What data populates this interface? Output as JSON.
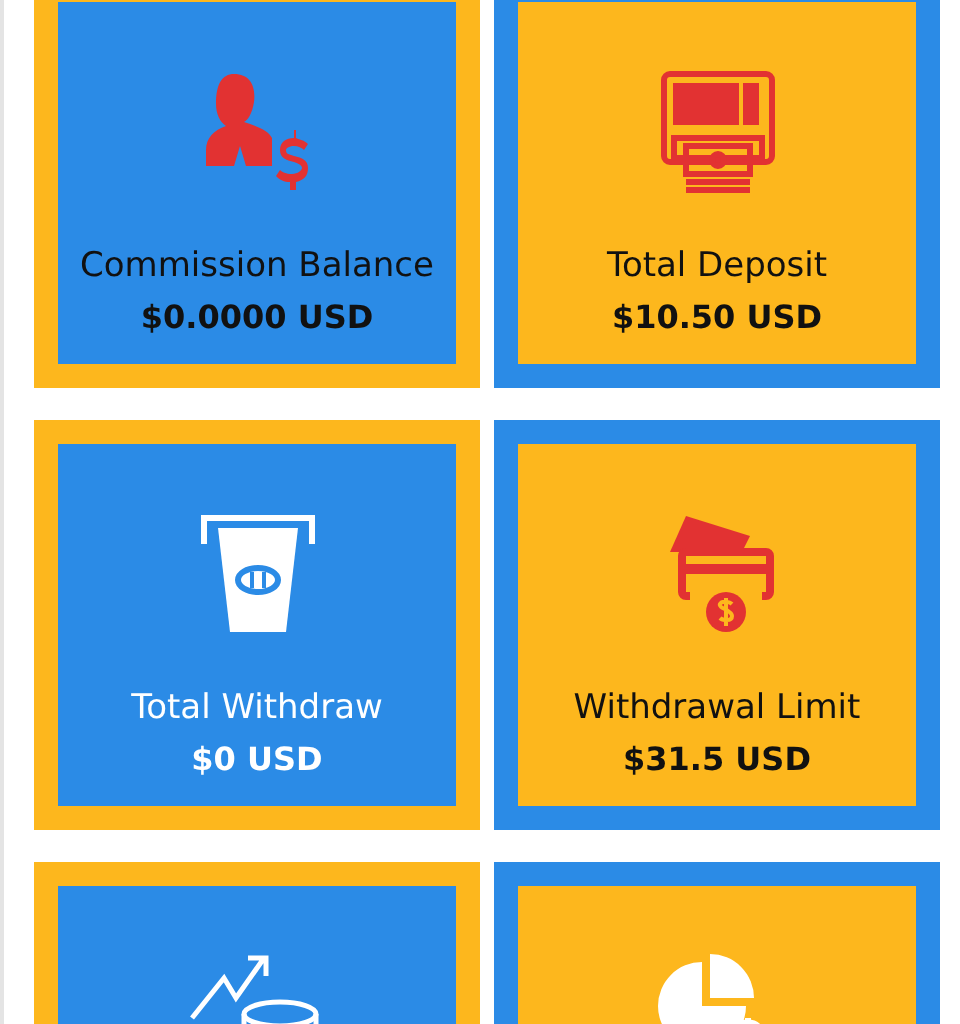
{
  "cards": [
    {
      "kind": "commission",
      "title": "Commission Balance",
      "value": "$0.0000 USD"
    },
    {
      "kind": "deposit",
      "title": "Total Deposit",
      "value": "$10.50 USD"
    },
    {
      "kind": "withdraw",
      "title": "Total Withdraw",
      "value": "$0 USD"
    },
    {
      "kind": "limit",
      "title": "Withdrawal Limit",
      "value": "$31.5 USD"
    },
    {
      "kind": "growth"
    },
    {
      "kind": "pie"
    }
  ]
}
